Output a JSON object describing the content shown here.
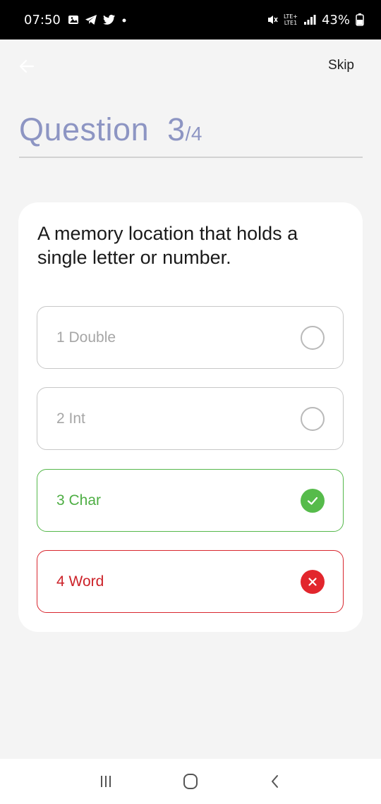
{
  "status_bar": {
    "time": "07:50",
    "battery": "43%",
    "network_lte_top": "LTE+",
    "network_lte_bottom": "LTE1",
    "icons_left": [
      "gallery-icon",
      "telegram-icon",
      "twitter-icon",
      "dot-icon"
    ],
    "icons_right": [
      "mute-icon",
      "volte-icon",
      "signal-icon",
      "battery-icon"
    ]
  },
  "header": {
    "back_icon": "arrow-left-icon",
    "skip_label": "Skip",
    "question_word": "Question",
    "question_current": "3",
    "question_total": "/4"
  },
  "card": {
    "prompt": "A memory location that holds a single letter or number.",
    "options": [
      {
        "label": "1 Double",
        "state": "unselected"
      },
      {
        "label": "2 Int",
        "state": "unselected"
      },
      {
        "label": "3 Char",
        "state": "correct"
      },
      {
        "label": "4 Word",
        "state": "wrong"
      }
    ]
  },
  "nav_bar": {
    "icons": [
      "recent-apps-icon",
      "home-icon",
      "back-icon"
    ]
  },
  "colors": {
    "accent_title": "#8d95c3",
    "correct": "#56bb4b",
    "wrong": "#e2262d",
    "background": "#f4f4f4"
  }
}
